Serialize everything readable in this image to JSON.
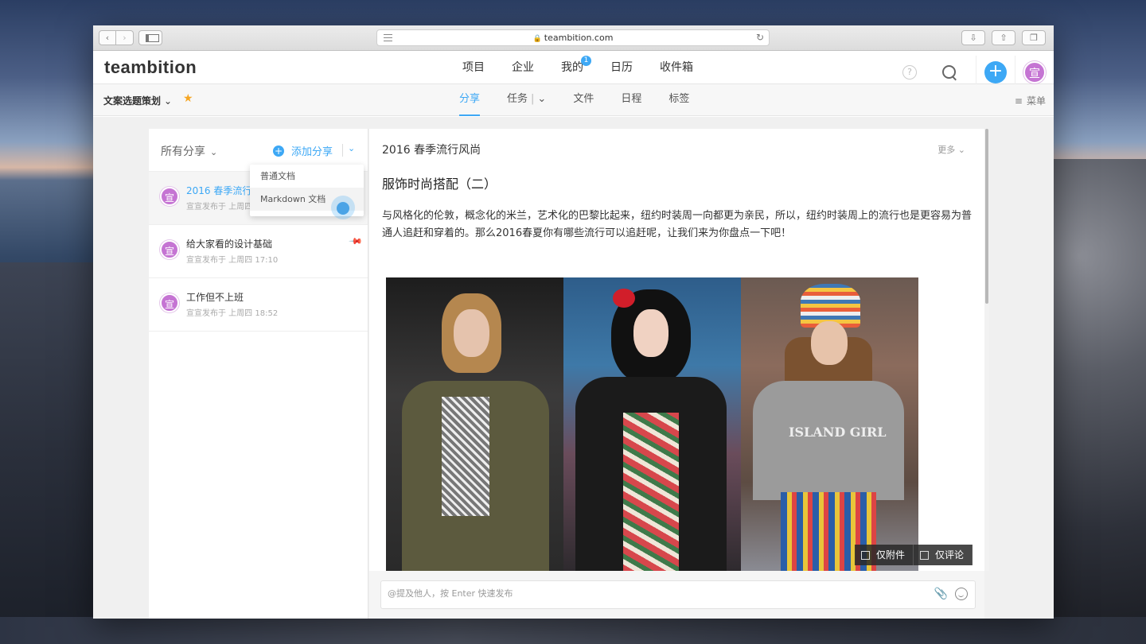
{
  "browser": {
    "url": "teambition.com",
    "back_icon": "chevron-left-icon",
    "forward_icon": "chevron-right-icon"
  },
  "app": {
    "logo": "teambition",
    "nav": [
      {
        "label": "项目"
      },
      {
        "label": "企业"
      },
      {
        "label": "我的",
        "badge": "1"
      },
      {
        "label": "日历"
      },
      {
        "label": "收件箱"
      }
    ],
    "help": "?",
    "add": "+",
    "avatar": "宣",
    "accent": "#3da8f5"
  },
  "project": {
    "name": "文案选题策划",
    "tabs": [
      "分享",
      "任务",
      "文件",
      "日程",
      "标签"
    ],
    "active_tab": "分享",
    "menu_label": "菜单"
  },
  "shares": {
    "filter_label": "所有分享",
    "add_label": "添加分享",
    "dropdown": [
      "普通文档",
      "Markdown 文档"
    ],
    "items": [
      {
        "title": "2016 春季流行风尚",
        "meta": "宣宣发布于 上周四 17:10",
        "avatar": "宣",
        "active": true
      },
      {
        "title": "给大家看的设计基础",
        "meta": "宣宣发布于 上周四 17:10",
        "avatar": "宣",
        "pinned": true
      },
      {
        "title": "工作但不上班",
        "meta": "宣宣发布于 上周四 18:52",
        "avatar": "宣"
      }
    ]
  },
  "document": {
    "header": "2016 春季流行风尚",
    "more": "更多",
    "title": "服饰时尚搭配（二）",
    "body": "与风格化的伦敦，概念化的米兰，艺术化的巴黎比起来，纽约时装周一向都更为亲民，所以，纽约时装周上的流行也是更容易为普通人追赶和穿着的。那么2016春夏你有哪些流行可以追赶呢，让我们来为你盘点一下吧！",
    "image_text": "ISLAND GIRL",
    "filters": [
      "仅附件",
      "仅评论"
    ]
  },
  "comment": {
    "placeholder": "@提及他人，按 Enter 快速发布"
  }
}
